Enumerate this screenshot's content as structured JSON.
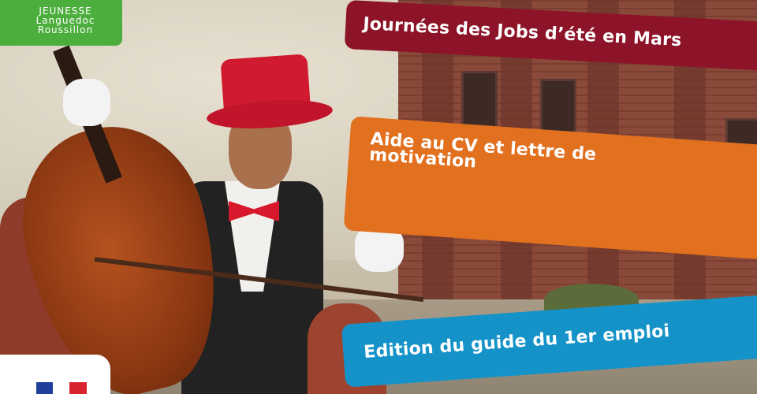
{
  "logo": {
    "line1": "JEUNESSE",
    "line2": "Languedoc",
    "line3": "Roussillon",
    "color": "#4cae3c"
  },
  "banners": [
    {
      "text": "Journées des Jobs d’été en Mars",
      "color": "#8c1328"
    },
    {
      "text": "Aide au CV et lettre de motivation",
      "color": "#e1701f"
    },
    {
      "text": "Edition du guide du 1er emploi",
      "color": "#1593c8"
    }
  ]
}
